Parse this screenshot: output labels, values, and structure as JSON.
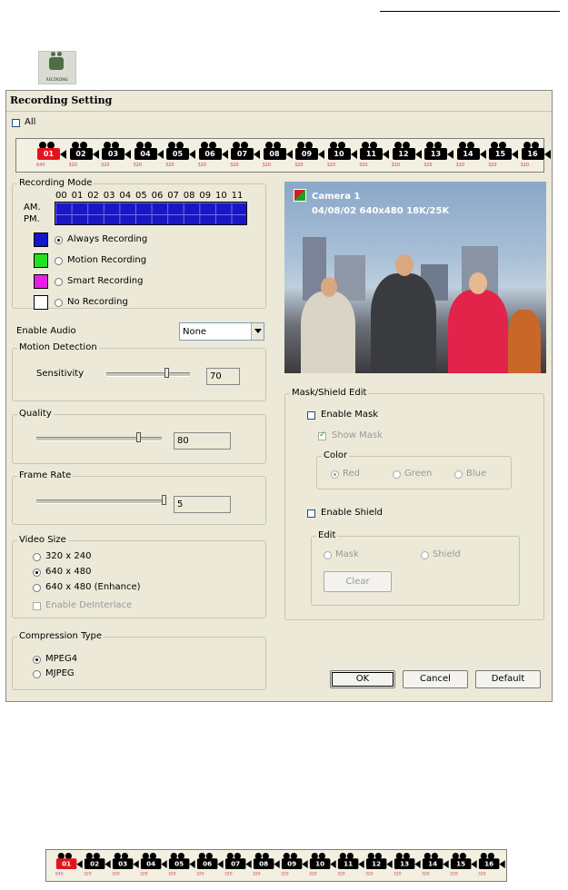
{
  "page": {
    "icon_label": "RECORDING"
  },
  "dialog": {
    "title": "Recording Setting",
    "all_label": "All",
    "cameras": [
      {
        "num": "01",
        "res": "640",
        "active": true
      },
      {
        "num": "02",
        "res": "320"
      },
      {
        "num": "03",
        "res": "320"
      },
      {
        "num": "04",
        "res": "320"
      },
      {
        "num": "05",
        "res": "320"
      },
      {
        "num": "06",
        "res": "320"
      },
      {
        "num": "07",
        "res": "320"
      },
      {
        "num": "08",
        "res": "320"
      },
      {
        "num": "09",
        "res": "320"
      },
      {
        "num": "10",
        "res": "320"
      },
      {
        "num": "11",
        "res": "320"
      },
      {
        "num": "12",
        "res": "320"
      },
      {
        "num": "13",
        "res": "320"
      },
      {
        "num": "14",
        "res": "320"
      },
      {
        "num": "15",
        "res": "320"
      },
      {
        "num": "16",
        "res": "320"
      }
    ],
    "recording_mode": {
      "label": "Recording Mode",
      "hours": [
        "00",
        "01",
        "02",
        "03",
        "04",
        "05",
        "06",
        "07",
        "08",
        "09",
        "10",
        "11"
      ],
      "am": "AM.",
      "pm": "PM.",
      "options": [
        {
          "label": "Always Recording",
          "color": "#1414c8",
          "selected": true
        },
        {
          "label": "Motion Recording",
          "color": "#22e022",
          "selected": false
        },
        {
          "label": "Smart Recording",
          "color": "#e61ee6",
          "selected": false
        },
        {
          "label": "No Recording",
          "color": "#ffffff",
          "selected": false
        }
      ]
    },
    "enable_audio": {
      "label": "Enable Audio",
      "value": "None"
    },
    "motion_detection": {
      "label": "Motion Detection",
      "sensitivity_label": "Sensitivity",
      "value": "70",
      "level": 70
    },
    "quality": {
      "label": "Quality",
      "value": "80",
      "level": 80
    },
    "frame_rate": {
      "label": "Frame Rate",
      "value": "5",
      "level": 100
    },
    "video_size": {
      "label": "Video Size",
      "options": [
        "320 x 240",
        "640 x 480",
        "640 x 480 (Enhance)"
      ],
      "selected_index": 1,
      "deinterlace_label": "Enable DeInterlace"
    },
    "compression": {
      "label": "Compression Type",
      "options": [
        "MPEG4",
        "MJPEG"
      ],
      "selected_index": 0
    },
    "preview": {
      "camera": "Camera 1",
      "info": "04/08/02  640x480 18K/25K"
    },
    "mask_shield": {
      "label": "Mask/Shield Edit",
      "enable_mask": "Enable Mask",
      "show_mask": "Show Mask",
      "color_label": "Color",
      "colors": [
        "Red",
        "Green",
        "Blue"
      ],
      "enable_shield": "Enable Shield",
      "edit_label": "Edit",
      "edit_options": [
        "Mask",
        "Shield"
      ],
      "clear": "Clear"
    },
    "buttons": {
      "ok": "OK",
      "cancel": "Cancel",
      "default": "Default"
    }
  },
  "bottom_cameras": [
    {
      "num": "01",
      "res": "640",
      "active": true
    },
    {
      "num": "02",
      "res": "320"
    },
    {
      "num": "03",
      "res": "320"
    },
    {
      "num": "04",
      "res": "320"
    },
    {
      "num": "05",
      "res": "320"
    },
    {
      "num": "06",
      "res": "320"
    },
    {
      "num": "07",
      "res": "320"
    },
    {
      "num": "08",
      "res": "320"
    },
    {
      "num": "09",
      "res": "320"
    },
    {
      "num": "10",
      "res": "320"
    },
    {
      "num": "11",
      "res": "320"
    },
    {
      "num": "12",
      "res": "320"
    },
    {
      "num": "13",
      "res": "320"
    },
    {
      "num": "14",
      "res": "320"
    },
    {
      "num": "15",
      "res": "320"
    },
    {
      "num": "16",
      "res": "320"
    }
  ]
}
